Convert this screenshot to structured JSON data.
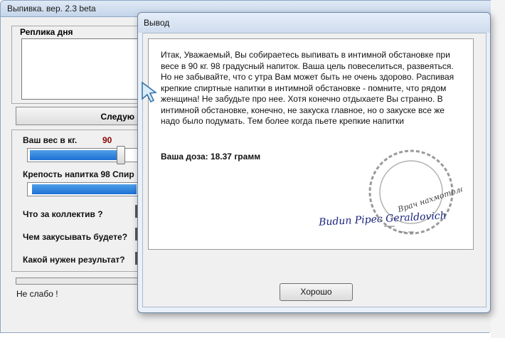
{
  "back_window": {
    "title": "Выпивка. вер. 2.3 beta",
    "phrase_group_label": "Реплика дня",
    "next_button_label": "Следую",
    "weight_label": "Ваш вес в кг.",
    "weight_value": "90",
    "weight_slider_fraction": 0.85,
    "strength_label": "Крепость напитка 98   Спир",
    "strength_slider_fraction": 0.98,
    "collective_label": "Что за коллектив ?",
    "snack_label": "Чем закусывать будете?",
    "result_label": "Какой нужен результат?",
    "status": "Не слабо !"
  },
  "dialog": {
    "title": "Вывод",
    "message": "Итак, Уважаемый, Вы собираетесь выпивать в интимной обстановке при весе в 90 кг. 98 градусный напиток. Ваша цель повеселиться, развеяться. Но не забывайте, что с утра Вам может быть не очень здорово. Распивая крепкие спиртные напитки в интимной обстановке - помните, что рядом женщина! Не забудьте про нее. Хотя конечно отдыхаете Вы странно. В интимной обстановке, конечно, не закуска главное, но о закуске все же надо было подумать. Тем более когда пьете крепкие напитки",
    "dose_label": "Ваша доза:  18.37 грамм",
    "stamp_text": "Врач нахмотолог",
    "signature": "Budun Pipec Geraldovich",
    "ok_button_label": "Хорошо"
  },
  "colors": {
    "slider_fill": "#1e70d4",
    "weight_value": "#8b0000",
    "signature_ink": "#1a237e"
  }
}
